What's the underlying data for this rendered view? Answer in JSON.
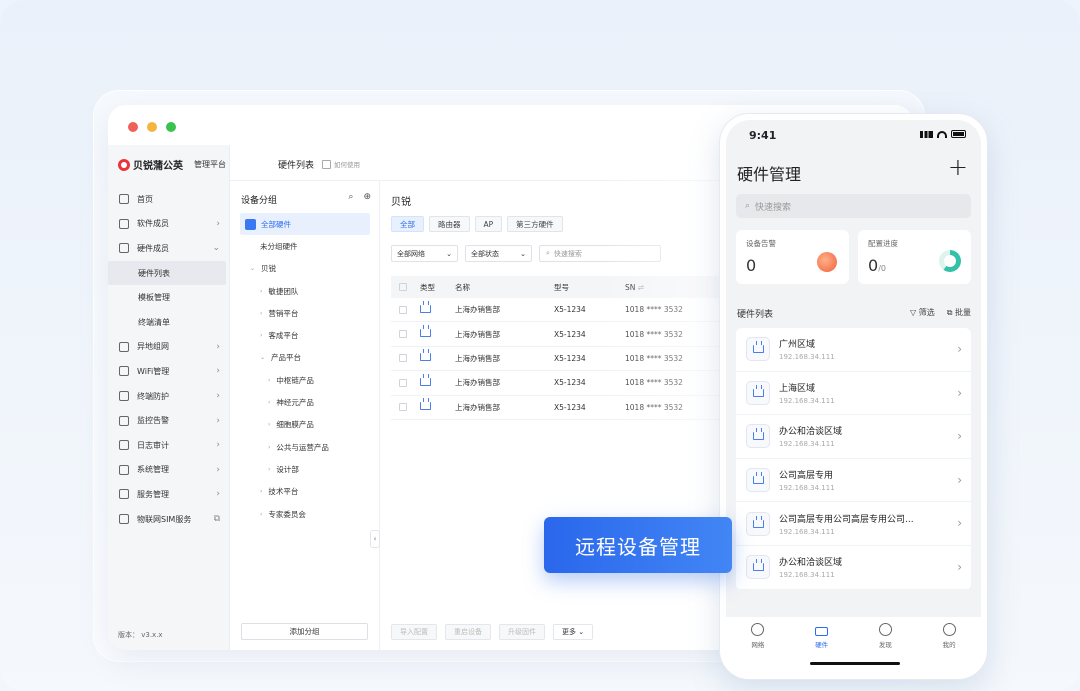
{
  "desktop": {
    "window_dots": [
      "#f0605a",
      "#f5b43f",
      "#39c24f"
    ],
    "brand": "贝锐蒲公英",
    "brand_sub": "管理平台",
    "page_title": "硬件列表",
    "help": "如何使用",
    "nav": [
      {
        "label": "首页",
        "icon": "home-icon",
        "chev": ""
      },
      {
        "label": "软件成员",
        "icon": "user-icon",
        "chev": "›"
      },
      {
        "label": "硬件成员",
        "icon": "hardware-user-icon",
        "chev": "⌄"
      },
      {
        "label": "硬件列表",
        "sub": true,
        "active": true
      },
      {
        "label": "模板管理",
        "sub": true
      },
      {
        "label": "终端清单",
        "sub": true
      },
      {
        "label": "异地组网",
        "icon": "network-icon",
        "chev": "›"
      },
      {
        "label": "WiFi管理",
        "icon": "wifi-icon",
        "chev": "›"
      },
      {
        "label": "终端防护",
        "icon": "shield-icon",
        "chev": "›"
      },
      {
        "label": "监控告警",
        "icon": "monitor-icon",
        "chev": "›"
      },
      {
        "label": "日志审计",
        "icon": "log-icon",
        "chev": "›"
      },
      {
        "label": "系统管理",
        "icon": "system-icon",
        "chev": "›"
      },
      {
        "label": "服务管理",
        "icon": "service-icon",
        "chev": "›"
      },
      {
        "label": "物联网SIM服务",
        "icon": "sim-icon",
        "chev": "⧉"
      }
    ],
    "version": "版本： v3.x.x",
    "group_panel": {
      "title": "设备分组",
      "tree": [
        {
          "label": "全部硬件",
          "level": 0,
          "active": true,
          "arrow": ""
        },
        {
          "label": "未分组硬件",
          "level": 0,
          "arrow": ""
        },
        {
          "label": "贝锐",
          "level": 0,
          "arrow": "⌄"
        },
        {
          "label": "敏捷团队",
          "level": 1,
          "arrow": "›"
        },
        {
          "label": "营销平台",
          "level": 1,
          "arrow": "›"
        },
        {
          "label": "客成平台",
          "level": 1,
          "arrow": "›"
        },
        {
          "label": "产品平台",
          "level": 1,
          "arrow": "⌄"
        },
        {
          "label": "中枢链产品",
          "level": 2,
          "arrow": "›"
        },
        {
          "label": "神经元产品",
          "level": 2,
          "arrow": "›"
        },
        {
          "label": "细胞膜产品",
          "level": 2,
          "arrow": "›"
        },
        {
          "label": "公共与运营产品",
          "level": 2,
          "arrow": "›"
        },
        {
          "label": "设计部",
          "level": 2,
          "arrow": "›"
        },
        {
          "label": "技术平台",
          "level": 1,
          "arrow": "›"
        },
        {
          "label": "专家委员会",
          "level": 1,
          "arrow": "›"
        }
      ],
      "add_button": "添加分组"
    },
    "main": {
      "title": "贝锐",
      "tabs": [
        "全部",
        "路由器",
        "AP",
        "第三方硬件"
      ],
      "filter_network": "全部网络",
      "filter_status": "全部状态",
      "search_placeholder": "快速搜索",
      "columns": [
        "类型",
        "名称",
        "型号",
        "SN"
      ],
      "rows": [
        {
          "name": "上海办销售部",
          "model": "X5-1234",
          "sn": "1018 **** 3532"
        },
        {
          "name": "上海办销售部",
          "model": "X5-1234",
          "sn": "1018 **** 3532"
        },
        {
          "name": "上海办销售部",
          "model": "X5-1234",
          "sn": "1018 **** 3532"
        },
        {
          "name": "上海办销售部",
          "model": "X5-1234",
          "sn": "1018 **** 3532"
        },
        {
          "name": "上海办销售部",
          "model": "X5-1234",
          "sn": "1018 **** 3532"
        }
      ],
      "footer_buttons": [
        "导入配置",
        "重启设备",
        "升级固件"
      ],
      "more": "更多"
    }
  },
  "banner": "远程设备管理",
  "phone": {
    "time": "9:41",
    "title": "硬件管理",
    "plus": "+",
    "search_placeholder": "快速搜索",
    "stats": [
      {
        "label": "设备告警",
        "value": "0",
        "suffix": ""
      },
      {
        "label": "配置进度",
        "value": "0",
        "suffix": "/0"
      }
    ],
    "list_title": "硬件列表",
    "filter": "筛选",
    "batch": "批量",
    "items": [
      {
        "name": "广州区域",
        "ip": "192.168.34.111",
        "icon": "router-icon"
      },
      {
        "name": "上海区域",
        "ip": "192.168.34.111",
        "icon": "router-icon"
      },
      {
        "name": "办公和洽谈区域",
        "ip": "192.168.34.111",
        "icon": "box-device-icon"
      },
      {
        "name": "公司高层专用",
        "ip": "192.168.34.111",
        "icon": "router-icon"
      },
      {
        "name": "公司高层专用公司高层专用公司...",
        "ip": "192.168.34.111",
        "icon": "box-device-icon"
      },
      {
        "name": "办公和洽谈区域",
        "ip": "192.168.34.111",
        "icon": "router-icon"
      }
    ],
    "tabbar": [
      {
        "label": "网络",
        "active": false
      },
      {
        "label": "硬件",
        "active": true
      },
      {
        "label": "发现",
        "active": false
      },
      {
        "label": "我的",
        "active": false
      }
    ]
  }
}
